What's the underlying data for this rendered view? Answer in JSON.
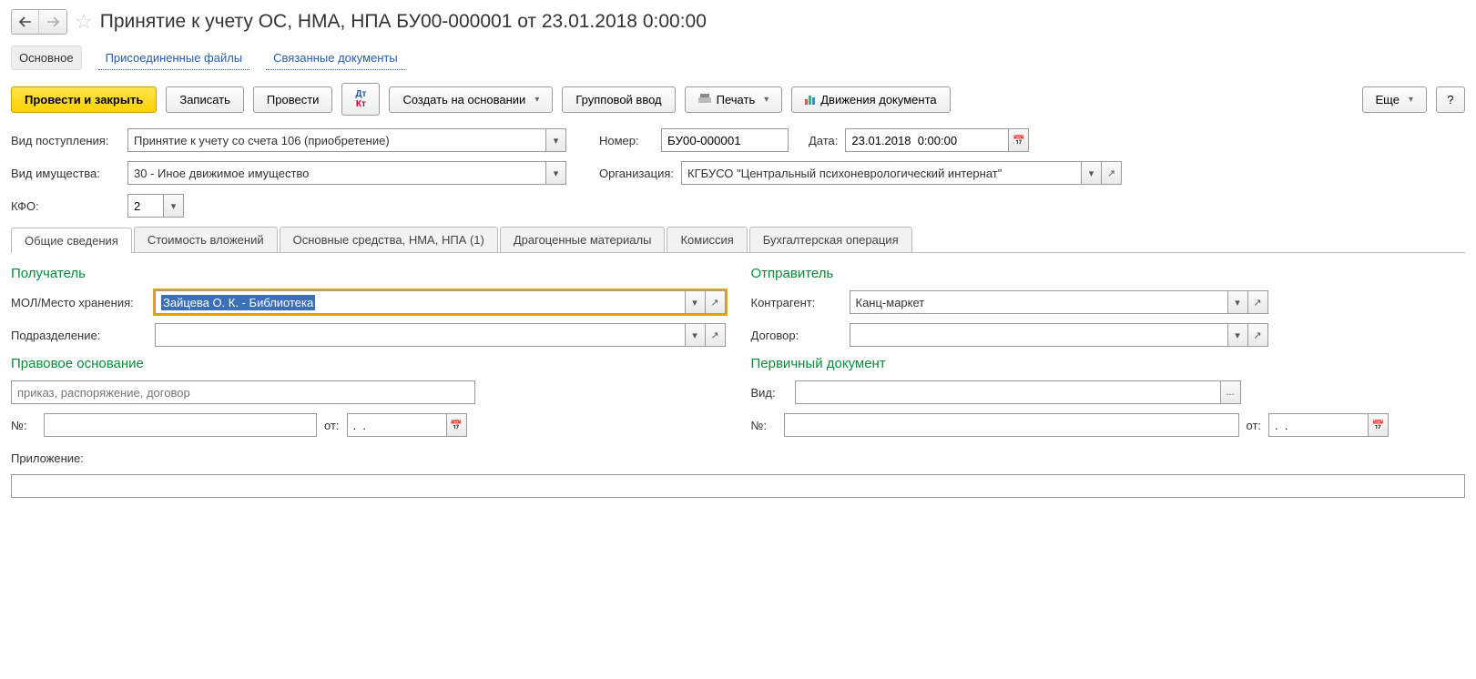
{
  "header": {
    "title": "Принятие к учету ОС, НМА, НПА БУ00-000001 от 23.01.2018 0:00:00"
  },
  "section_tabs": {
    "main": "Основное",
    "files": "Присоединенные файлы",
    "related": "Связанные документы"
  },
  "toolbar": {
    "post_close": "Провести и закрыть",
    "save": "Записать",
    "post": "Провести",
    "create_based": "Создать на основании",
    "group_input": "Групповой ввод",
    "print": "Печать",
    "movements": "Движения документа",
    "more": "Еще",
    "help": "?"
  },
  "form": {
    "receipt_type_label": "Вид поступления:",
    "receipt_type_value": "Принятие к учету со счета 106 (приобретение)",
    "number_label": "Номер:",
    "number_value": "БУ00-000001",
    "date_label": "Дата:",
    "date_value": "23.01.2018  0:00:00",
    "asset_type_label": "Вид имущества:",
    "asset_type_value": "30 - Иное движимое имущество",
    "org_label": "Организация:",
    "org_value": "КГБУСО \"Центральный психоневрологический интернат\"",
    "kfo_label": "КФО:",
    "kfo_value": "2"
  },
  "tabs": {
    "general": "Общие сведения",
    "cost": "Стоимость вложений",
    "assets": "Основные средства, НМА, НПА (1)",
    "precious": "Драгоценные материалы",
    "commission": "Комиссия",
    "accounting": "Бухгалтерская операция"
  },
  "recipient": {
    "title": "Получатель",
    "mol_label": "МОЛ/Место хранения:",
    "mol_value": "Зайцева О. К. - Библиотека",
    "dept_label": "Подразделение:",
    "dept_value": ""
  },
  "sender": {
    "title": "Отправитель",
    "counterparty_label": "Контрагент:",
    "counterparty_value": "Канц-маркет",
    "contract_label": "Договор:",
    "contract_value": ""
  },
  "legal": {
    "title": "Правовое основание",
    "placeholder": "приказ, распоряжение, договор",
    "no_label": "№:",
    "no_value": "",
    "from_label": "от:",
    "from_value": ".  ."
  },
  "primary_doc": {
    "title": "Первичный документ",
    "kind_label": "Вид:",
    "kind_value": "",
    "no_label": "№:",
    "no_value": "",
    "from_label": "от:",
    "from_value": ".  ."
  },
  "attachment": {
    "label": "Приложение:",
    "value": ""
  }
}
